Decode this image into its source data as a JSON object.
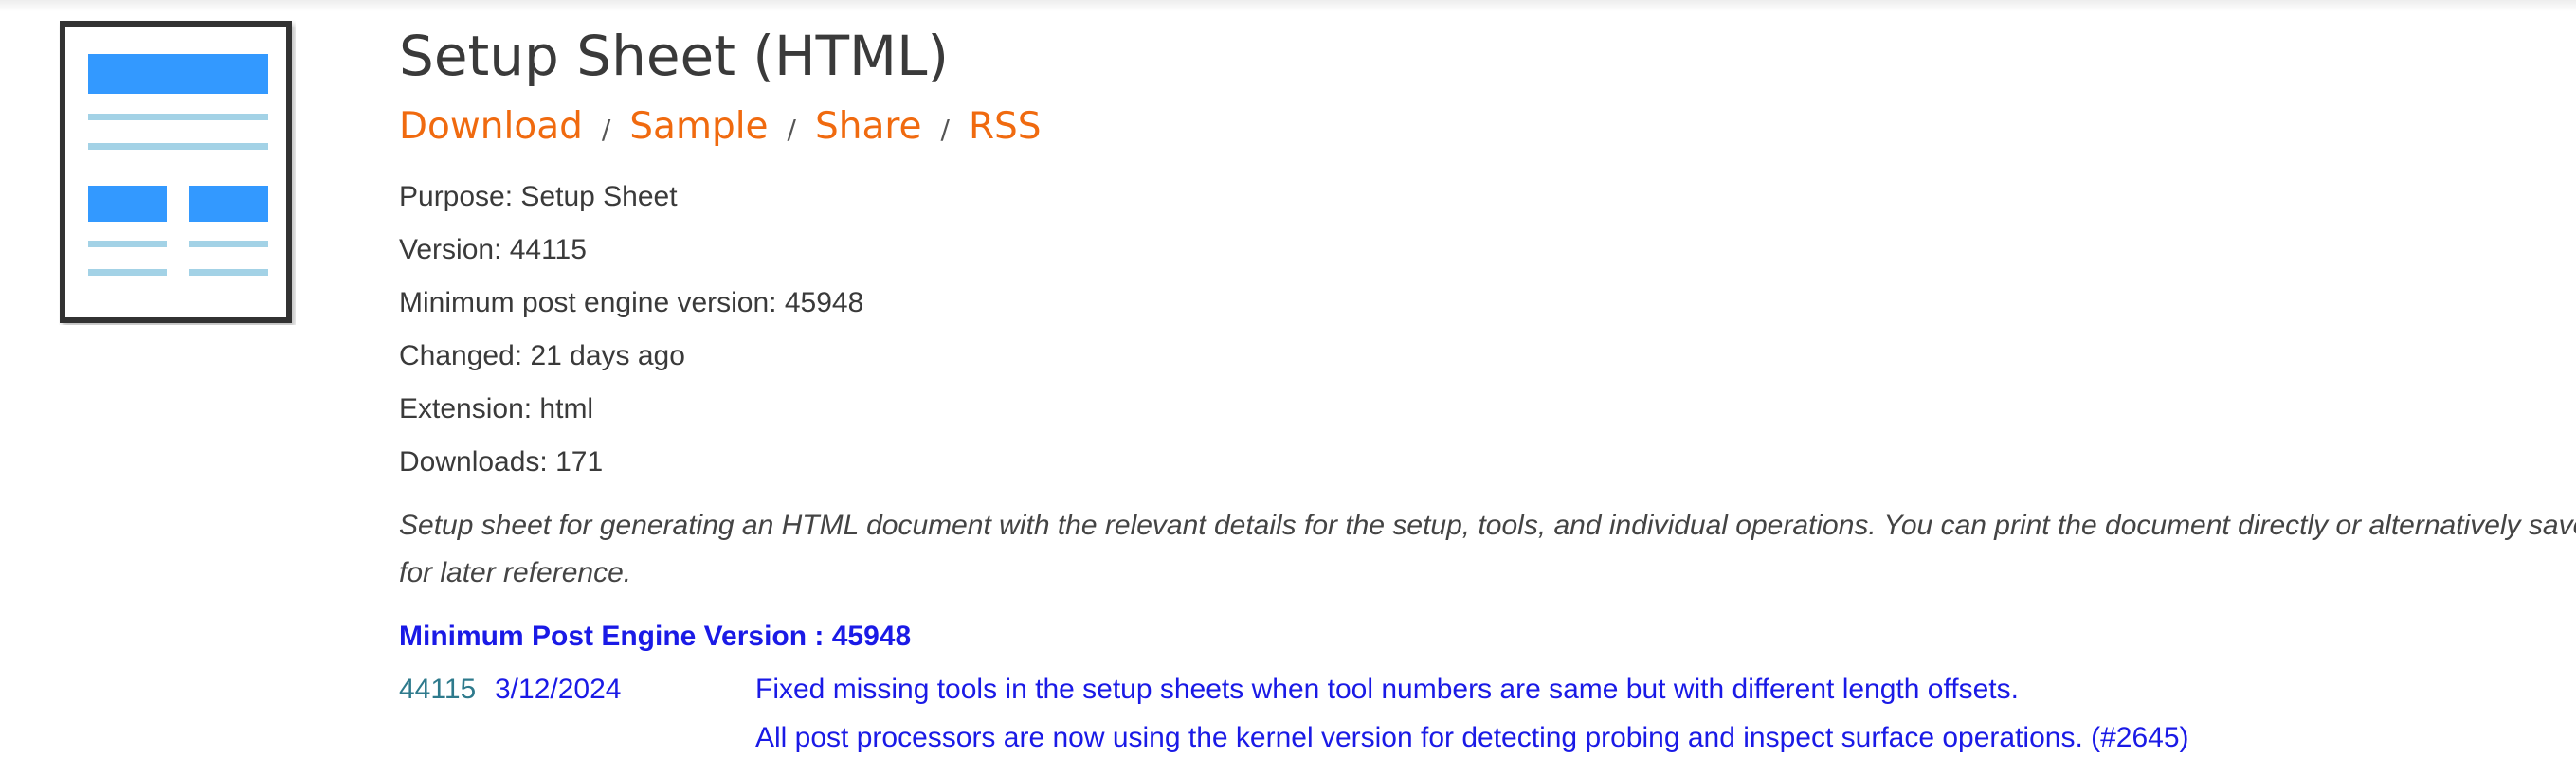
{
  "title": "Setup Sheet (HTML)",
  "actions": {
    "download": "Download",
    "sample": "Sample",
    "share": "Share",
    "rss": "RSS",
    "separator": "/"
  },
  "meta": [
    {
      "key": "purpose",
      "text": "Purpose: Setup Sheet"
    },
    {
      "key": "version",
      "text": "Version: 44115"
    },
    {
      "key": "min_engine",
      "text": "Minimum post engine version: 45948"
    },
    {
      "key": "changed",
      "text": "Changed: 21 days ago"
    },
    {
      "key": "extension",
      "text": "Extension: html"
    },
    {
      "key": "downloads",
      "text": "Downloads: 171"
    }
  ],
  "description": {
    "line1": "Setup sheet for generating an HTML document with the relevant details for the setup, tools, and individual operations. You can print the document directly or alternatively save it to disk",
    "line2": "for later reference."
  },
  "min_version_heading": "Minimum Post Engine Version : 45948",
  "changelog": [
    {
      "version": "44115",
      "date": "3/12/2024",
      "text": "Fixed missing tools in the setup sheets when tool numbers are same but with different length offsets."
    },
    {
      "version": "",
      "date": "",
      "text": "All post processors are now using the kernel version for detecting probing and inspect surface operations. (#2645)"
    }
  ],
  "colors": {
    "accent_orange": "#f06a0f",
    "link_blue": "#1a1ae6",
    "version_teal": "#2e7a8c",
    "icon_blue": "#3399ff",
    "icon_light_blue": "#a3d2e6",
    "icon_frame": "#333333"
  },
  "icons": {
    "post_icon": "document-layout-icon"
  }
}
